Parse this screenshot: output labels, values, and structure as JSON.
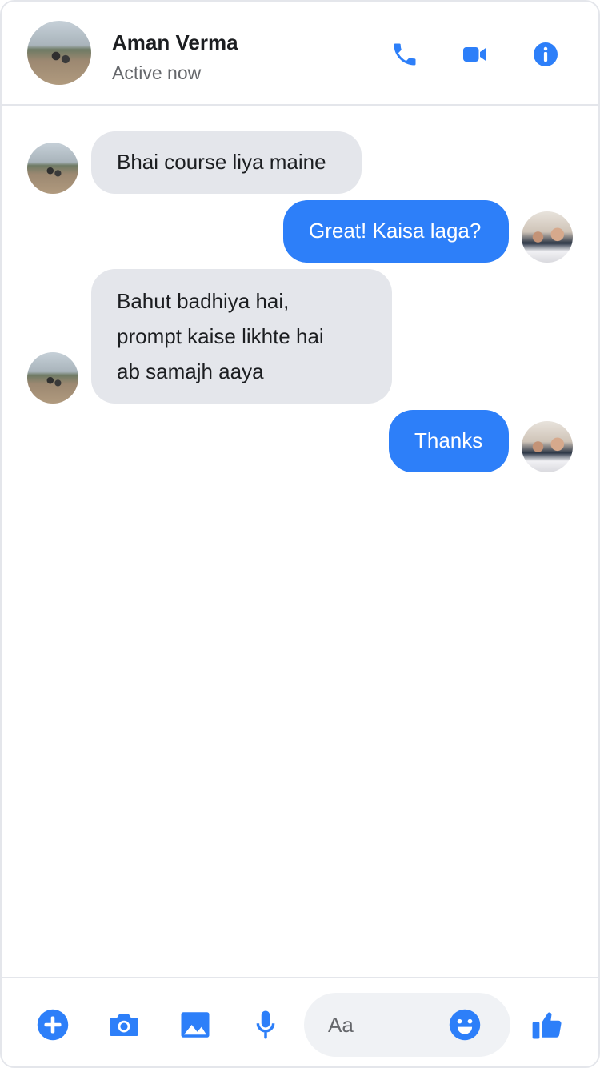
{
  "header": {
    "contact_name": "Aman Verma",
    "status": "Active now",
    "icons": [
      "phone-icon",
      "video-camera-icon",
      "info-icon"
    ]
  },
  "messages": [
    {
      "direction": "incoming",
      "lines": [
        "Bhai course liya maine"
      ]
    },
    {
      "direction": "outgoing",
      "lines": [
        "Great! Kaisa laga?"
      ]
    },
    {
      "direction": "incoming",
      "lines": [
        "Bahut badhiya hai,",
        "prompt kaise likhte hai",
        "ab samajh aaya"
      ]
    },
    {
      "direction": "outgoing",
      "lines": [
        "Thanks"
      ]
    }
  ],
  "composer": {
    "placeholder": "Aa",
    "icons": [
      "add-icon",
      "camera-icon",
      "image-icon",
      "microphone-icon",
      "emoji-icon",
      "thumbs-up-icon"
    ]
  },
  "colors": {
    "accent": "#2d7ff9",
    "incoming_bubble": "#e4e6eb",
    "outgoing_text": "#ffffff",
    "secondary_text": "#65676b"
  }
}
